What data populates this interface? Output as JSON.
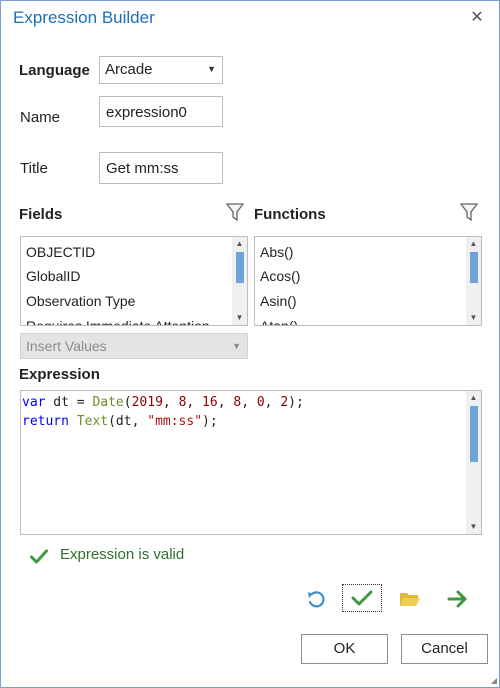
{
  "dialog": {
    "title": "Expression Builder"
  },
  "language": {
    "label": "Language",
    "value": "Arcade"
  },
  "name": {
    "label": "Name",
    "value": "expression0"
  },
  "title_field": {
    "label": "Title",
    "value": "Get mm:ss"
  },
  "fields": {
    "label": "Fields",
    "items": [
      "OBJECTID",
      "GlobalID",
      "Observation Type",
      "Requires Immediate Attention"
    ]
  },
  "functions": {
    "label": "Functions",
    "items": [
      "Abs()",
      "Acos()",
      "Asin()",
      "Atan()"
    ]
  },
  "insert_values": {
    "label": "Insert Values"
  },
  "expression": {
    "label": "Expression",
    "line1": {
      "kw": "var",
      "mid1": " dt = ",
      "fn": "Date",
      "open": "(",
      "n1": "2019",
      "c1": ", ",
      "n2": "8",
      "c2": ", ",
      "n3": "16",
      "c3": ", ",
      "n4": "8",
      "c4": ", ",
      "n5": "0",
      "c5": ", ",
      "n6": "2",
      "close": ");"
    },
    "line2": {
      "kw": "return",
      "sp": " ",
      "fn": "Text",
      "mid": "(dt, ",
      "str": "\"mm:ss\"",
      "close": ");"
    }
  },
  "status": {
    "text": "Expression is valid",
    "color": "#3c9a3c"
  },
  "toolbar": {
    "icons": [
      "undo-icon",
      "verify-icon",
      "folder-open-icon",
      "arrow-right-icon"
    ]
  },
  "buttons": {
    "ok": "OK",
    "cancel": "Cancel"
  },
  "colors": {
    "accent": "#1d6fb8",
    "scroll_thumb": "#6fa3d7"
  }
}
